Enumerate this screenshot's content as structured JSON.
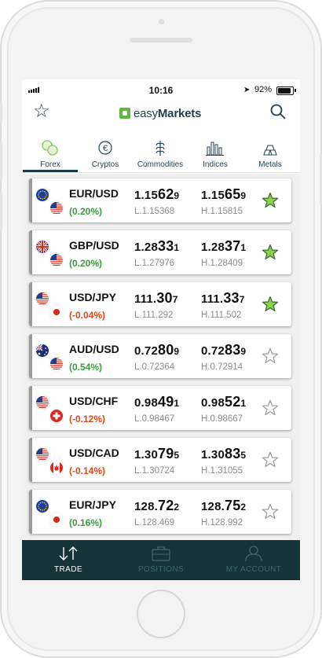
{
  "status_bar": {
    "time": "10:16",
    "battery": "92%"
  },
  "app": {
    "logo_prefix": "easy",
    "logo_suffix": "Markets"
  },
  "tabs": [
    {
      "label": "Forex",
      "icon": "forex-icon",
      "active": true
    },
    {
      "label": "Cryptos",
      "icon": "euro-coin-icon",
      "active": false
    },
    {
      "label": "Commodities",
      "icon": "wheat-icon",
      "active": false
    },
    {
      "label": "Indices",
      "icon": "bar-chart-icon",
      "active": false
    },
    {
      "label": "Metals",
      "icon": "gold-bars-icon",
      "active": false
    }
  ],
  "instruments": [
    {
      "pair": "EUR/USD",
      "change": "(0.20%)",
      "dir": "pos",
      "flags": [
        "eu",
        "us"
      ],
      "bid": {
        "pre": "1.15",
        "big": "62",
        "small": "9"
      },
      "ask": {
        "pre": "1.15",
        "big": "65",
        "small": "9"
      },
      "low": "L.1.15368",
      "high": "H.1.15815",
      "favorite": true
    },
    {
      "pair": "GBP/USD",
      "change": "(0.20%)",
      "dir": "pos",
      "flags": [
        "gb",
        "us"
      ],
      "bid": {
        "pre": "1.28",
        "big": "33",
        "small": "1"
      },
      "ask": {
        "pre": "1.28",
        "big": "37",
        "small": "1"
      },
      "low": "L.1.27976",
      "high": "H.1.28409",
      "favorite": true
    },
    {
      "pair": "USD/JPY",
      "change": "(-0.04%)",
      "dir": "neg",
      "flags": [
        "us",
        "jp"
      ],
      "bid": {
        "pre": "111.",
        "big": "30",
        "small": "7"
      },
      "ask": {
        "pre": "111.",
        "big": "33",
        "small": "7"
      },
      "low": "L.111.292",
      "high": "H.111.502",
      "favorite": true
    },
    {
      "pair": "AUD/USD",
      "change": "(0.54%)",
      "dir": "pos",
      "flags": [
        "au",
        "us"
      ],
      "bid": {
        "pre": "0.72",
        "big": "80",
        "small": "9"
      },
      "ask": {
        "pre": "0.72",
        "big": "83",
        "small": "9"
      },
      "low": "L.0.72364",
      "high": "H.0.72914",
      "favorite": false
    },
    {
      "pair": "USD/CHF",
      "change": "(-0.12%)",
      "dir": "neg",
      "flags": [
        "us",
        "ch"
      ],
      "bid": {
        "pre": "0.98",
        "big": "49",
        "small": "1"
      },
      "ask": {
        "pre": "0.98",
        "big": "52",
        "small": "1"
      },
      "low": "L.0.98467",
      "high": "H.0.98667",
      "favorite": false
    },
    {
      "pair": "USD/CAD",
      "change": "(-0.14%)",
      "dir": "neg",
      "flags": [
        "us",
        "ca"
      ],
      "bid": {
        "pre": "1.30",
        "big": "79",
        "small": "5"
      },
      "ask": {
        "pre": "1.30",
        "big": "83",
        "small": "5"
      },
      "low": "L.1.30724",
      "high": "H.1.31055",
      "favorite": false
    },
    {
      "pair": "EUR/JPY",
      "change": "(0.16%)",
      "dir": "pos",
      "flags": [
        "eu",
        "jp"
      ],
      "bid": {
        "pre": "128.",
        "big": "72",
        "small": "2"
      },
      "ask": {
        "pre": "128.",
        "big": "75",
        "small": "2"
      },
      "low": "L.128.469",
      "high": "H.128.992",
      "favorite": false
    }
  ],
  "bottom_nav": [
    {
      "label": "TRADE",
      "icon": "up-down-arrows-icon",
      "active": true
    },
    {
      "label": "POSITIONS",
      "icon": "briefcase-icon",
      "active": false
    },
    {
      "label": "MY ACCOUNT",
      "icon": "user-icon",
      "active": false
    }
  ],
  "colors": {
    "positive": "#3b9a3b",
    "negative": "#e0461b",
    "favorite_star": "#8fd14f",
    "bottom_bar": "#163338"
  }
}
